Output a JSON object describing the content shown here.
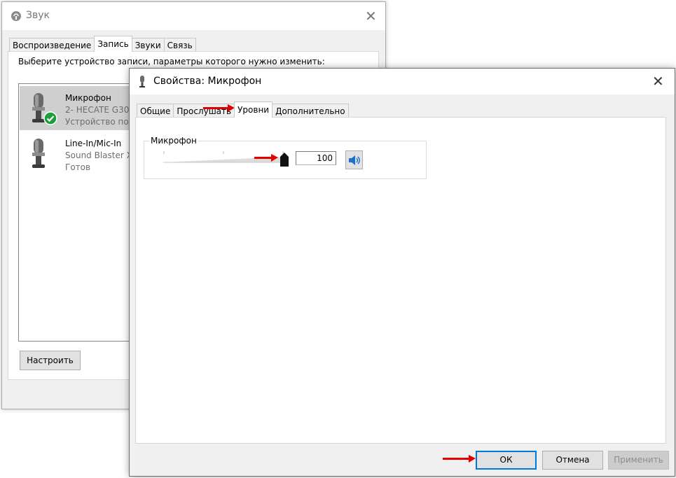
{
  "sound_dialog": {
    "title": "Звук",
    "tabs": [
      "Воспроизведение",
      "Запись",
      "Звуки",
      "Связь"
    ],
    "active_tab_index": 1,
    "instruction": "Выберите устройство записи, параметры которого нужно изменить:",
    "devices": [
      {
        "name": "Микрофон",
        "line2": "2- HECATE G30",
        "line3": "Устройство по у",
        "selected": true,
        "default_check": true,
        "icon": "microphone-icon"
      },
      {
        "name": "Line-In/Mic-In",
        "line2": "Sound Blaster X",
        "line3": "Готов",
        "selected": false,
        "default_check": false,
        "icon": "microphone-icon"
      }
    ],
    "configure_button": "Настроить"
  },
  "props_dialog": {
    "title": "Свойства: Микрофон",
    "tabs": [
      "Общие",
      "Прослушать",
      "Уровни",
      "Дополнительно"
    ],
    "active_tab_index": 2,
    "levels": {
      "group_label": "Микрофон",
      "value": "100",
      "slider_level": 1.0,
      "speaker_icon": "speaker-icon"
    },
    "buttons": {
      "ok": "ОК",
      "cancel": "Отмена",
      "apply": "Применить"
    }
  },
  "colors": {
    "arrow": "#e30000",
    "default_button_border": "#0078d7",
    "check_green": "#1e9e3a"
  }
}
